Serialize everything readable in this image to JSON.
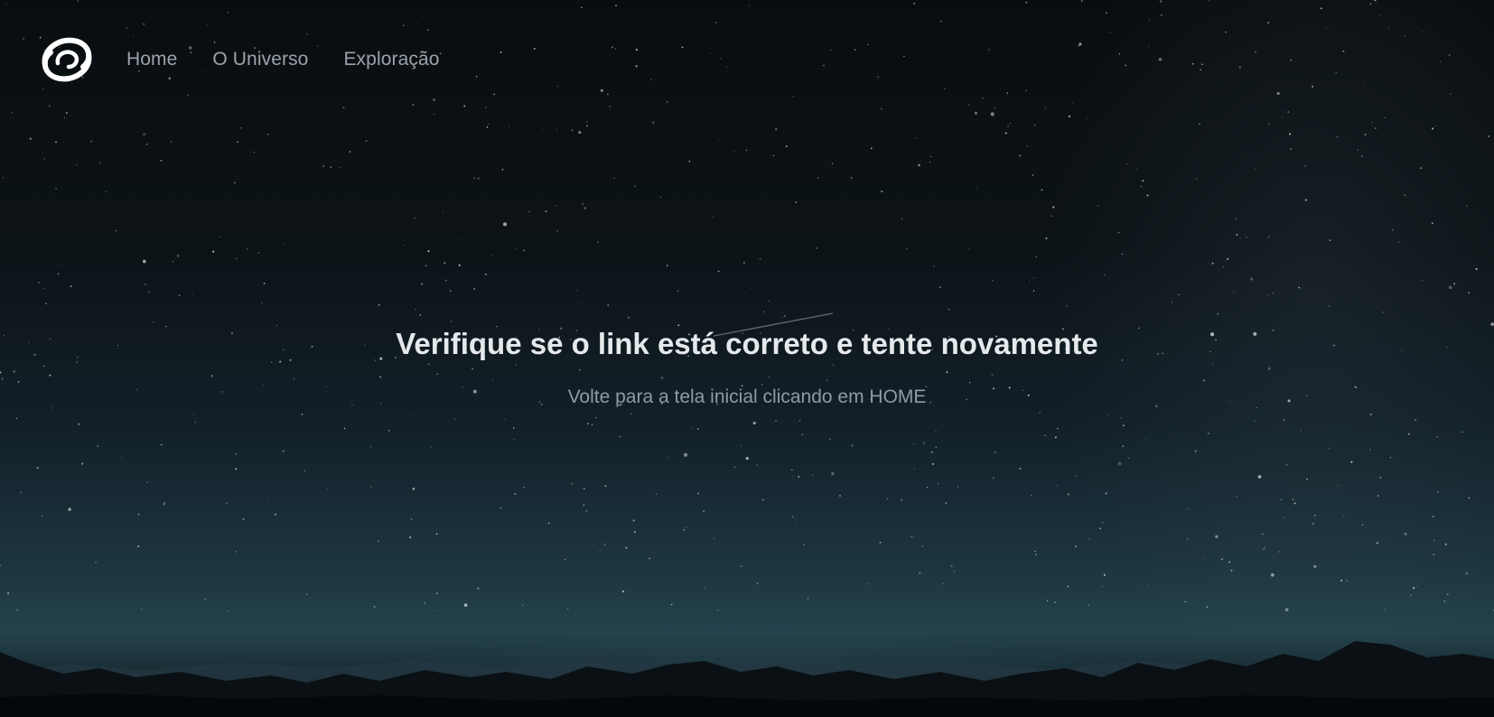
{
  "nav": {
    "logo_icon": "spiral-galaxy-icon",
    "links": [
      {
        "label": "Home"
      },
      {
        "label": "O Universo"
      },
      {
        "label": "Exploração"
      }
    ]
  },
  "message": {
    "title": "Verifique se o link está correto e tente novamente",
    "subtitle": "Volte para a tela inicial clicando em HOME"
  },
  "colors": {
    "sky_top": "#090d10",
    "horizon_glow": "#24434d",
    "title_text": "#e6e9eb",
    "nav_text": "#9aa3a9"
  }
}
